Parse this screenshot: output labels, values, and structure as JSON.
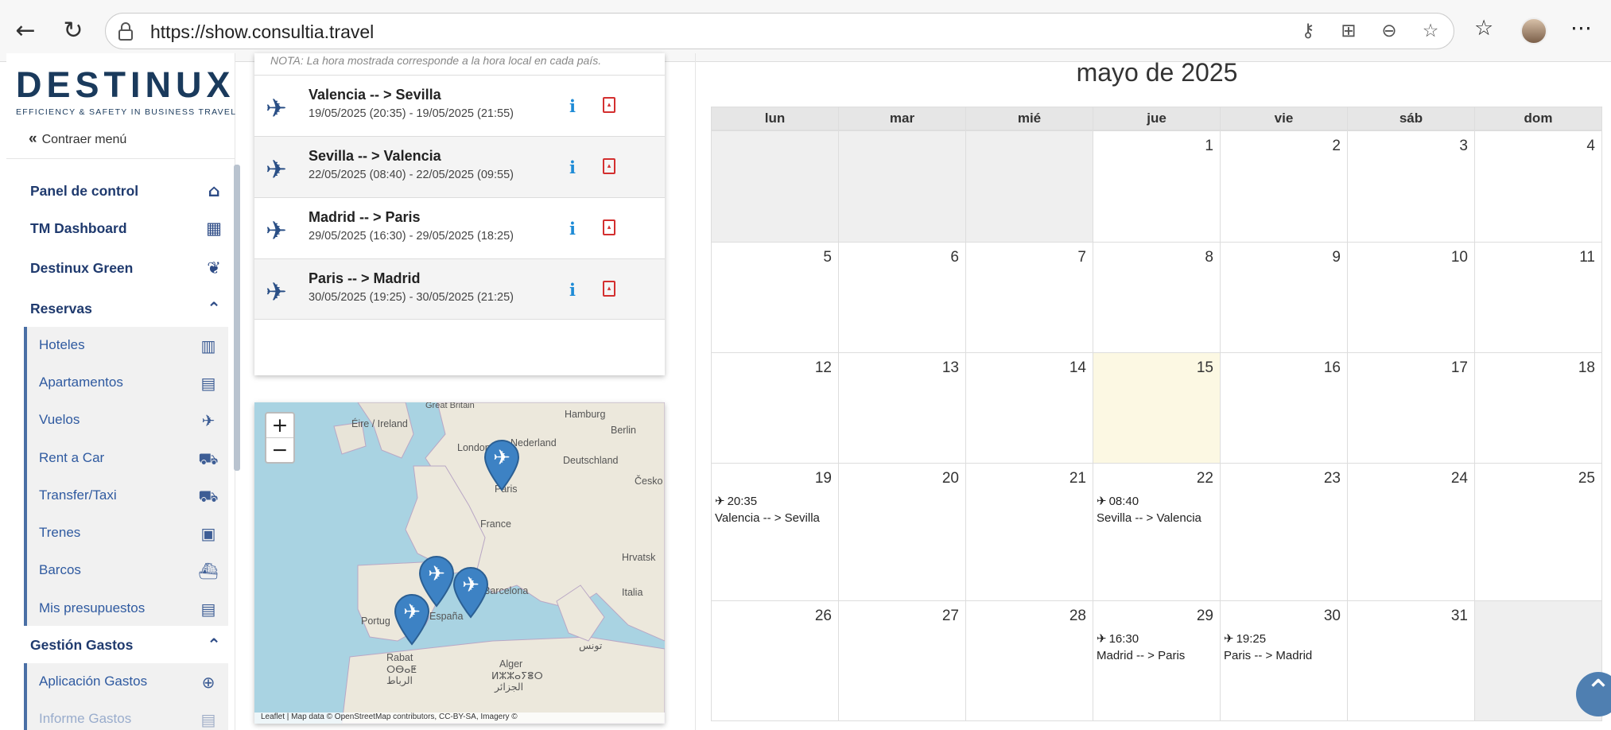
{
  "browser": {
    "url": "https://show.consultia.travel"
  },
  "sidebar": {
    "logo_word": "DESTINUX",
    "logo_tagline": "EFFICIENCY & SAFETY IN BUSINESS TRAVEL",
    "collapse_label": "Contraer menú",
    "items": [
      {
        "label": "Panel de control",
        "icon": "home-icon"
      },
      {
        "label": "TM Dashboard",
        "icon": "briefcase-icon"
      },
      {
        "label": "Destinux Green",
        "icon": "leaf-icon"
      },
      {
        "label": "Reservas",
        "icon": "chevron-up-icon"
      }
    ],
    "reservas_sub": [
      {
        "label": "Hoteles",
        "icon": "hotel-icon"
      },
      {
        "label": "Apartamentos",
        "icon": "building-icon"
      },
      {
        "label": "Vuelos",
        "icon": "plane-icon"
      },
      {
        "label": "Rent a Car",
        "icon": "car-icon"
      },
      {
        "label": "Transfer/Taxi",
        "icon": "taxi-icon"
      },
      {
        "label": "Trenes",
        "icon": "train-icon"
      },
      {
        "label": "Barcos",
        "icon": "ship-icon"
      },
      {
        "label": "Mis presupuestos",
        "icon": "file-icon"
      }
    ],
    "gastos": {
      "label": "Gestión Gastos",
      "icon": "chevron-up-icon"
    },
    "gastos_sub": [
      {
        "label": "Aplicación Gastos",
        "icon": "plus-circle-icon"
      },
      {
        "label": "Informe Gastos",
        "icon": "file-icon"
      }
    ]
  },
  "trips": {
    "note": "NOTA: La hora mostrada corresponde a la hora local en cada país.",
    "flights": [
      {
        "route": "Valencia -- > Sevilla",
        "dates": "19/05/2025 (20:35) - 19/05/2025 (21:55)"
      },
      {
        "route": "Sevilla -- > Valencia",
        "dates": "22/05/2025 (08:40) - 22/05/2025 (09:55)"
      },
      {
        "route": "Madrid -- > Paris",
        "dates": "29/05/2025 (16:30) - 29/05/2025 (18:25)"
      },
      {
        "route": "Paris -- > Madrid",
        "dates": "30/05/2025 (19:25) - 30/05/2025 (21:25)"
      }
    ]
  },
  "map": {
    "zoom_in": "+",
    "zoom_out": "−",
    "labels": {
      "great_britain": "Great Britain",
      "hamburg": "Hamburg",
      "eire": "Éire / Ireland",
      "london": "London",
      "nederland": "Nederland",
      "berlin": "Berlin",
      "deutschland": "Deutschland",
      "cesko": "Česko",
      "paris": "Paris",
      "france": "France",
      "hrvatska": "Hrvatsk",
      "barcelona": "Barcelona",
      "italia": "Italia",
      "portugal": "Portug",
      "espana": "España",
      "tunis": "تونس",
      "rabat": "Rabat",
      "rabat_tf": "ⵔⴱⴰⵟ",
      "rabat_ar": "الرباط",
      "alger": "Alger",
      "alger_tf": "ⵍⵣⵣⴰⵢⴻⵔ",
      "alger_ar": "الجزائر"
    },
    "attribution": "Leaflet | Map data © OpenStreetMap contributors, CC-BY-SA, Imagery ©"
  },
  "calendar": {
    "title": "mayo de 2025",
    "weekdays": [
      "lun",
      "mar",
      "mié",
      "jue",
      "vie",
      "sáb",
      "dom"
    ],
    "weeks": [
      [
        {
          "d": "",
          "o": true
        },
        {
          "d": "",
          "o": true
        },
        {
          "d": "",
          "o": true
        },
        {
          "d": "1"
        },
        {
          "d": "2"
        },
        {
          "d": "3"
        },
        {
          "d": "4"
        }
      ],
      [
        {
          "d": "5"
        },
        {
          "d": "6"
        },
        {
          "d": "7"
        },
        {
          "d": "8"
        },
        {
          "d": "9"
        },
        {
          "d": "10"
        },
        {
          "d": "11"
        }
      ],
      [
        {
          "d": "12"
        },
        {
          "d": "13"
        },
        {
          "d": "14"
        },
        {
          "d": "15",
          "today": true
        },
        {
          "d": "16"
        },
        {
          "d": "17"
        },
        {
          "d": "18"
        }
      ],
      [
        {
          "d": "19",
          "time": "20:35",
          "title": "Valencia -- > Sevilla"
        },
        {
          "d": "20"
        },
        {
          "d": "21"
        },
        {
          "d": "22",
          "time": "08:40",
          "title": "Sevilla -- > Valencia"
        },
        {
          "d": "23"
        },
        {
          "d": "24"
        },
        {
          "d": "25"
        }
      ],
      [
        {
          "d": "26"
        },
        {
          "d": "27"
        },
        {
          "d": "28"
        },
        {
          "d": "29",
          "time": "16:30",
          "title": "Madrid -- > Paris"
        },
        {
          "d": "30",
          "time": "19:25",
          "title": "Paris -- > Madrid"
        },
        {
          "d": "31"
        },
        {
          "d": "",
          "o": true
        }
      ]
    ]
  }
}
